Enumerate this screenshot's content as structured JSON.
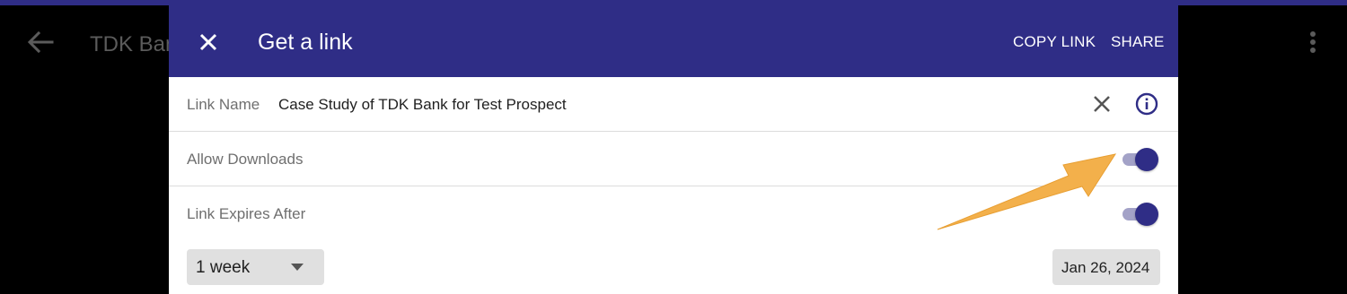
{
  "background": {
    "title": "TDK Bank"
  },
  "dialog": {
    "title": "Get a link",
    "actions": {
      "copy_link": "COPY LINK",
      "share": "SHARE"
    },
    "link_name": {
      "label": "Link Name",
      "value": "Case Study of TDK Bank for Test Prospect"
    },
    "allow_downloads": {
      "label": "Allow Downloads",
      "enabled": true
    },
    "link_expires": {
      "label": "Link Expires After",
      "enabled": true,
      "duration": "1 week",
      "date": "Jan 26, 2024"
    }
  },
  "colors": {
    "header": "#2f2d86",
    "toggle_thumb": "#2f2d86",
    "toggle_track": "#a3a2c7",
    "annotation_arrow": "#f3b04b"
  },
  "icons": [
    "back-arrow-icon",
    "more-vert-icon",
    "close-icon",
    "clear-icon",
    "info-icon",
    "dropdown-caret-icon"
  ]
}
